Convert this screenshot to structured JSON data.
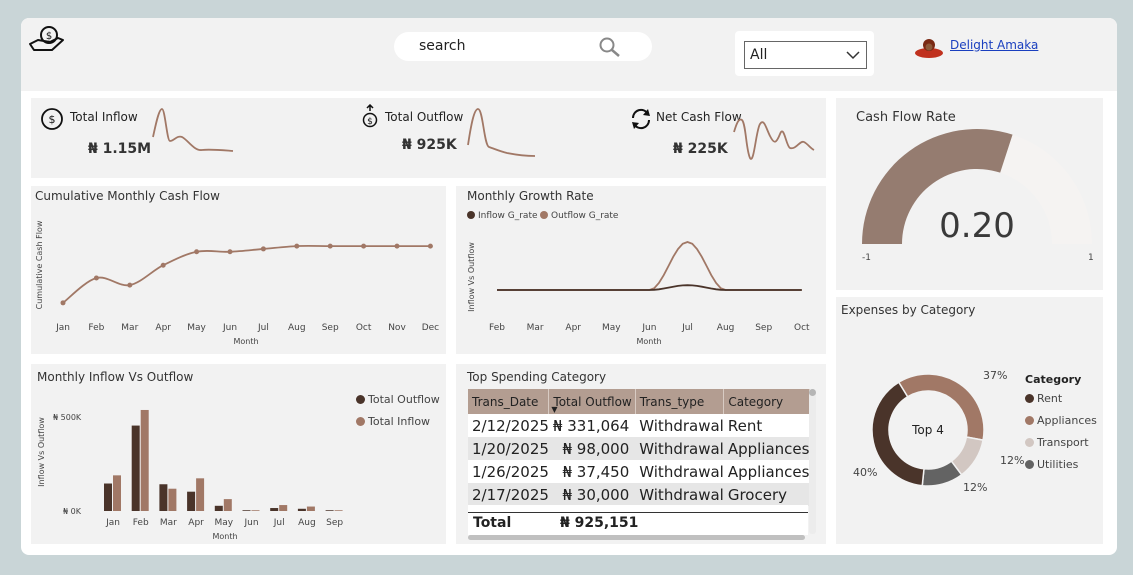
{
  "header": {
    "search_placeholder": "search",
    "filter_value": "All",
    "user_name": "Delight Amaka"
  },
  "kpis": [
    {
      "label": "Total Inflow",
      "value": "₦ 1.15M"
    },
    {
      "label": "Total Outflow",
      "value": "₦ 925K"
    },
    {
      "label": "Net Cash Flow",
      "value": "₦ 225K"
    }
  ],
  "cumulative": {
    "title": "Cumulative Monthly Cash Flow",
    "ylabel": "Cumulative Cash Flow",
    "xlabel": "Month"
  },
  "growth": {
    "title": "Monthly Growth Rate",
    "ylabel": "Inflow Vs Outflow",
    "xlabel": "Month",
    "legend": [
      "Inflow G_rate",
      "Outflow G_rate"
    ]
  },
  "inout": {
    "title": "Monthly Inflow Vs Outflow",
    "ylabel": "Inflow Vs Outflow",
    "xlabel": "Month",
    "legend": [
      "Total Outflow",
      "Total Inflow"
    ],
    "ytick_top": "₦ 500K",
    "ytick_zero": "₦ 0K"
  },
  "gauge": {
    "title": "Cash Flow Rate",
    "value": "0.20",
    "min": "-1",
    "max": "1"
  },
  "donut": {
    "title": "Expenses by Category",
    "center": "Top 4",
    "legend_title": "Category",
    "legend": [
      "Rent",
      "Appliances",
      "Transport",
      "Utilities"
    ],
    "labels": [
      "37%",
      "12%",
      "12%",
      "40%"
    ]
  },
  "spending": {
    "title": "Top Spending Category",
    "columns": [
      "Trans_Date",
      "Total Outflow",
      "Trans_type",
      "Category"
    ],
    "rows": [
      [
        "2/12/2025",
        "₦ 331,064",
        "Withdrawal",
        "Rent"
      ],
      [
        "1/20/2025",
        "₦ 98,000",
        "Withdrawal",
        "Appliances"
      ],
      [
        "1/26/2025",
        "₦ 37,450",
        "Withdrawal",
        "Appliances"
      ],
      [
        "2/17/2025",
        "₦ 30,000",
        "Withdrawal",
        "Grocery"
      ]
    ],
    "total_label": "Total",
    "total_value": "₦ 925,151"
  },
  "colors": {
    "dark": "#4a342a",
    "light": "#a17866",
    "gauge": "#957c70",
    "gray": "#636363",
    "pale": "#d2c7c2"
  },
  "chart_data": [
    {
      "type": "line",
      "title": "Cumulative Monthly Cash Flow",
      "xlabel": "Month",
      "ylabel": "Cumulative Cash Flow",
      "categories": [
        "Jan",
        "Feb",
        "Mar",
        "Apr",
        "May",
        "Jun",
        "Jul",
        "Aug",
        "Sep",
        "Oct",
        "Nov",
        "Dec"
      ],
      "values": [
        20,
        55,
        45,
        73,
        92,
        92,
        96,
        100,
        100,
        100,
        100,
        100
      ],
      "ylim": [
        0,
        110
      ],
      "grid": false
    },
    {
      "type": "line",
      "title": "Monthly Growth Rate",
      "xlabel": "Month",
      "ylabel": "Inflow Vs Outflow",
      "categories": [
        "Feb",
        "Mar",
        "Apr",
        "May",
        "Jun",
        "Jul",
        "Aug",
        "Sep",
        "Oct"
      ],
      "series": [
        {
          "name": "Inflow G_rate",
          "values": [
            0,
            0,
            0,
            0,
            0,
            0.3,
            0,
            0,
            0
          ]
        },
        {
          "name": "Outflow G_rate",
          "values": [
            0,
            0,
            0,
            0,
            0,
            3.0,
            0,
            0,
            0
          ]
        }
      ],
      "legend": "top-left"
    },
    {
      "type": "bar",
      "title": "Monthly Inflow Vs Outflow",
      "xlabel": "Month",
      "ylabel": "Inflow Vs Outflow",
      "categories": [
        "Jan",
        "Feb",
        "Mar",
        "Apr",
        "May",
        "Jun",
        "Jul",
        "Aug",
        "Sep"
      ],
      "series": [
        {
          "name": "Total Outflow",
          "values": [
            185,
            575,
            180,
            130,
            35,
            5,
            20,
            15,
            5
          ]
        },
        {
          "name": "Total Inflow",
          "values": [
            240,
            680,
            150,
            220,
            80,
            5,
            40,
            30,
            5
          ]
        }
      ],
      "ylim": [
        0,
        700
      ],
      "legend": "top-right"
    },
    {
      "type": "pie",
      "title": "Expenses by Category",
      "categories": [
        "Appliances",
        "Transport",
        "Utilities",
        "Rent"
      ],
      "values": [
        37,
        12,
        12,
        40
      ]
    }
  ]
}
